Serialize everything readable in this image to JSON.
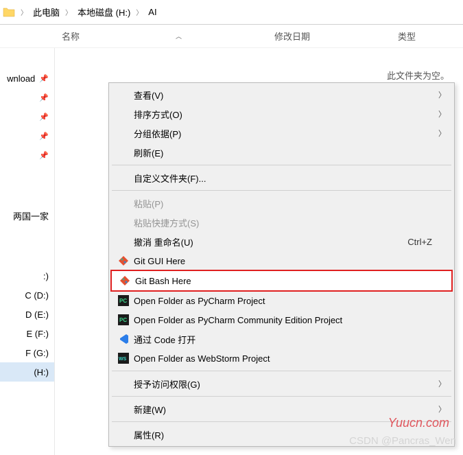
{
  "breadcrumb": {
    "items": [
      "此电脑",
      "本地磁盘 (H:)",
      "AI"
    ]
  },
  "columns": {
    "name": "名称",
    "date": "修改日期",
    "type": "类型"
  },
  "sidebar": {
    "quick": [
      {
        "label": "wnload",
        "pinned": true,
        "blue": true
      },
      {
        "label": "",
        "pinned": true
      },
      {
        "label": "",
        "pinned": true
      },
      {
        "label": "",
        "pinned": true
      },
      {
        "label": "",
        "pinned": true
      }
    ],
    "group2": [
      {
        "label": "两国一家"
      }
    ],
    "drives": [
      {
        "label": ":)"
      },
      {
        "label": "C (D:)"
      },
      {
        "label": "D (E:)"
      },
      {
        "label": "E (F:)"
      },
      {
        "label": "F (G:)"
      },
      {
        "label": "(H:)",
        "selected": true
      }
    ]
  },
  "main": {
    "empty": "此文件夹为空。"
  },
  "menu": {
    "view": "查看(V)",
    "sort": "排序方式(O)",
    "group": "分组依据(P)",
    "refresh": "刷新(E)",
    "custom": "自定义文件夹(F)...",
    "paste": "粘贴(P)",
    "paste_shortcut": "粘贴快捷方式(S)",
    "undo": "撤消 重命名(U)",
    "undo_sc": "Ctrl+Z",
    "git_gui": "Git GUI Here",
    "git_bash": "Git Bash Here",
    "pycharm": "Open Folder as PyCharm Project",
    "pycharm_ce": "Open Folder as PyCharm Community Edition Project",
    "vscode": "通过 Code 打开",
    "webstorm": "Open Folder as WebStorm Project",
    "grant": "授予访问权限(G)",
    "new": "新建(W)",
    "props": "属性(R)"
  },
  "watermark1": "Yuucn.com",
  "watermark2": "CSDN @Pancras_Wen"
}
